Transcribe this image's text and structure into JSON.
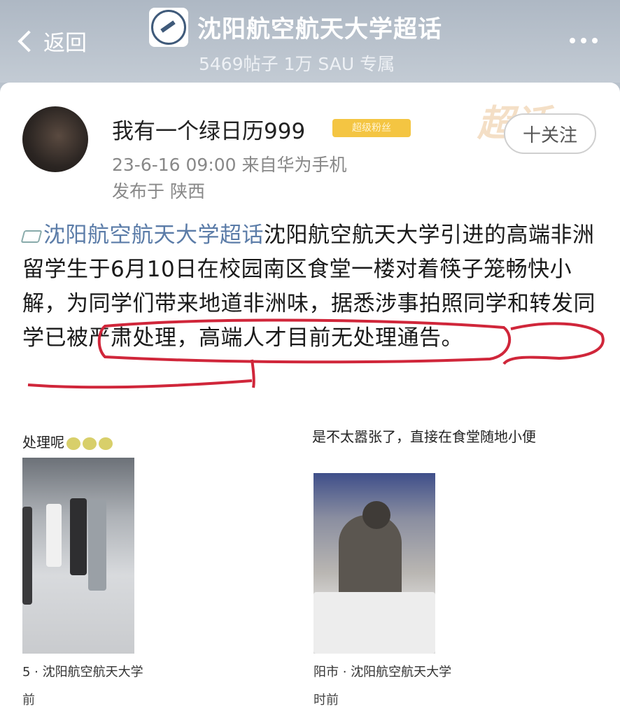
{
  "header": {
    "back_label": "返回",
    "title": "沈阳航空航天大学超话",
    "subtitle": "5469帖子 1万 SAU 专属"
  },
  "post": {
    "watermark": "超话",
    "username": "我有一个绿日历999",
    "badge": "超级粉丝",
    "meta": "23-6-16 09:00  来自华为手机",
    "location": "发布于 陕西",
    "follow_label": "十关注",
    "topic": "沈阳航空航天大学超话",
    "body": "沈阳航空航天大学引进的高端非洲留学生于6月10日在校园南区食堂一楼对着筷子笼畅快小解，为同学们带来地道非洲味，据悉涉事拍照同学和转发同学已被严肃处理，高端人才目前无处理通告。"
  },
  "embeds": {
    "left_caption": "处理呢",
    "left_footer": "5 · 沈阳航空航天大学",
    "left_footer2": "前",
    "right_caption": "是不太嚣张了，直接在食堂随地小便",
    "right_footer": "阳市 · 沈阳航空航天大学",
    "right_footer2": "时前"
  },
  "colors": {
    "header_bg": "#b7c0ca",
    "topic_link": "#5b7ca8",
    "annotation_red": "#d0263a",
    "badge": "#f4c542"
  }
}
